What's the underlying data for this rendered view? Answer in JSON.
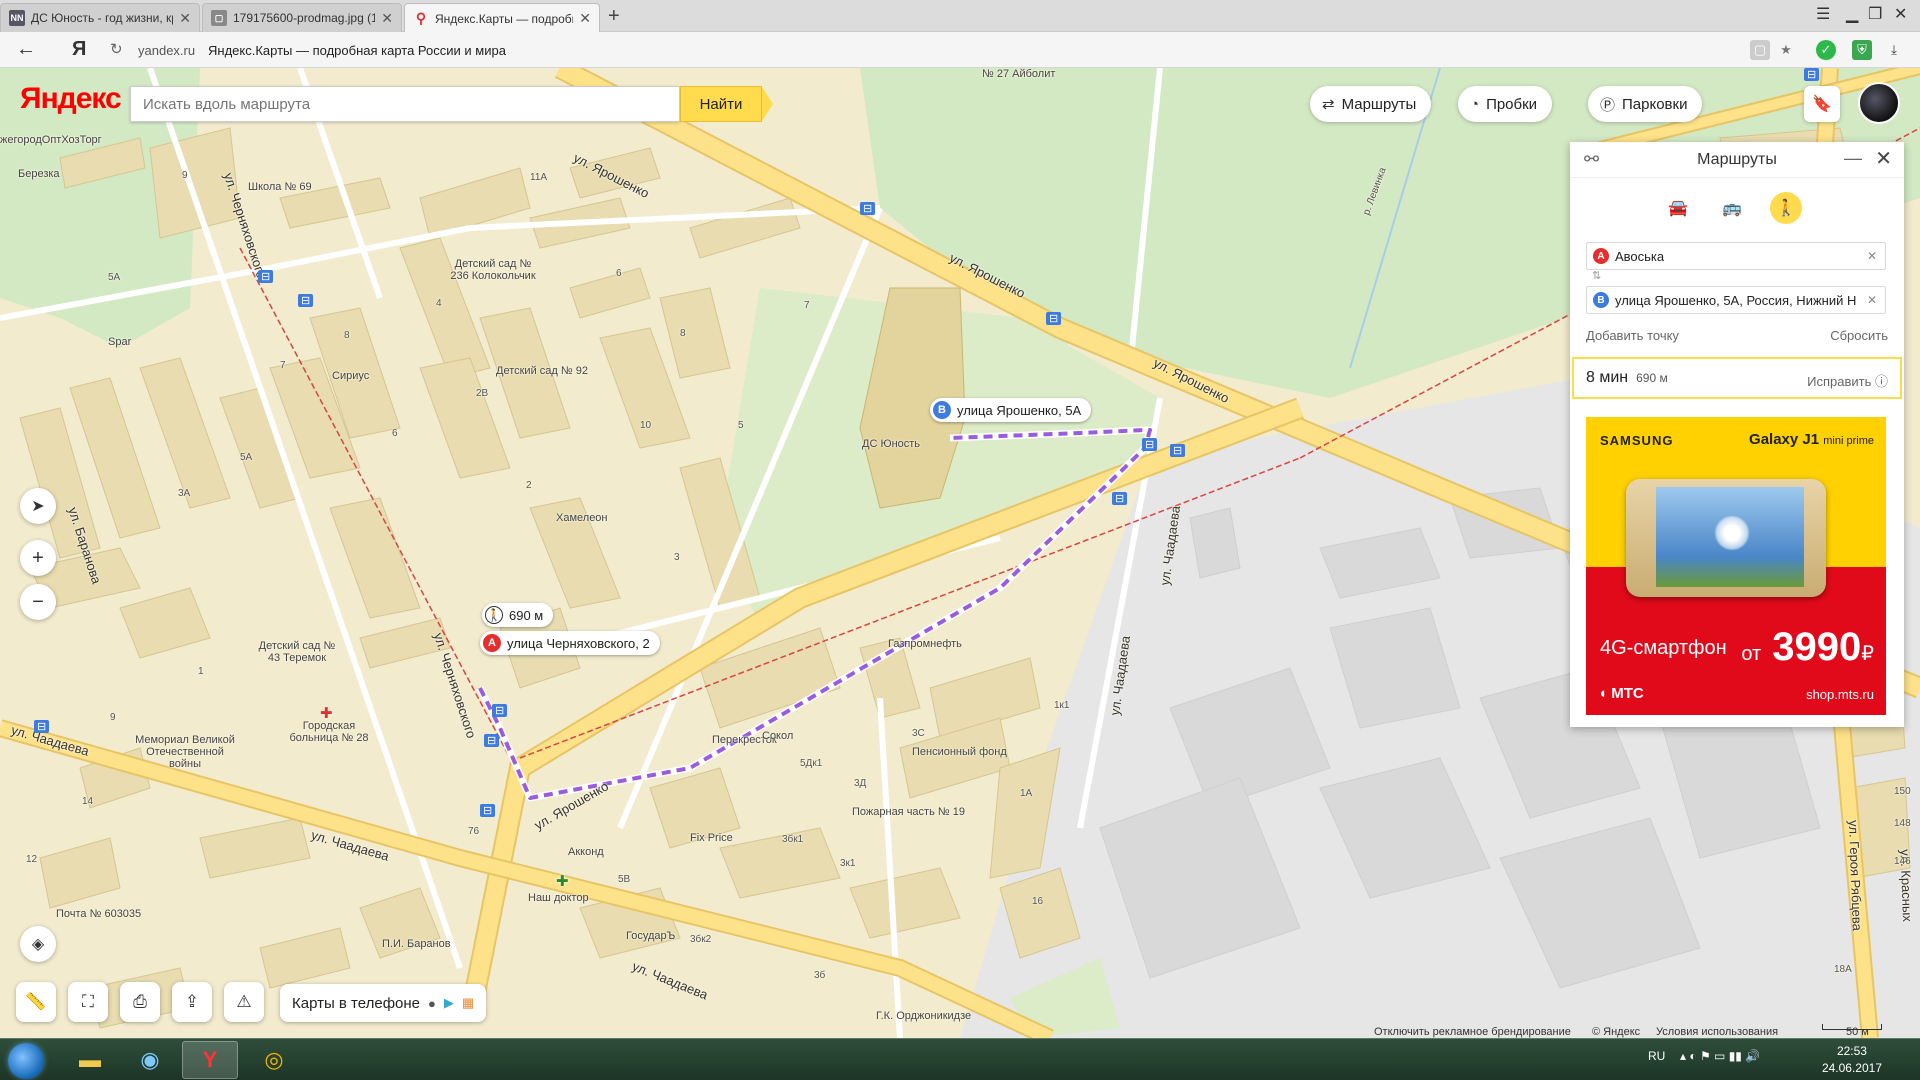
{
  "browser": {
    "tabs": [
      {
        "title": "ДС Юность - год жизни, кр",
        "favicon": "nn-favicon"
      },
      {
        "title": "179175600-prodmag.jpg (1920",
        "favicon": "image-favicon"
      },
      {
        "title": "Яндекс.Карты — подробн",
        "favicon": "maps-pin-favicon"
      }
    ],
    "url_domain": "yandex.ru",
    "url_title": "Яндекс.Карты — подробная карта России и мира"
  },
  "header": {
    "logo": "Яндекс",
    "search_placeholder": "Искать вдоль маршрута",
    "search_button": "Найти",
    "routes_label": "Маршруты",
    "traffic_label": "Пробки",
    "parking_label": "Парковки"
  },
  "route_markers": {
    "distance": "690 м",
    "start_letter": "A",
    "start_label": "улица Черняховского, 2",
    "end_letter": "B",
    "end_label": "улица Ярошенко, 5А"
  },
  "panel": {
    "title": "Маршруты",
    "waypoint_a_letter": "A",
    "waypoint_a": "Авоська",
    "waypoint_b_letter": "B",
    "waypoint_b": "улица Ярошенко, 5А, Россия, Нижний Н",
    "add_point": "Добавить точку",
    "reset": "Сбросить",
    "result_time": "8 мин",
    "result_dist": "690 м",
    "fix": "Исправить",
    "active_mode": "pedestrian"
  },
  "ad": {
    "brand": "SAMSUNG",
    "model": "Galaxy J1",
    "model_suffix": "mini prime",
    "slogan": "4G-смартфон",
    "price_prefix": "от",
    "price": "3990",
    "currency": "₽",
    "operator": "МТС",
    "shop": "shop.mts.ru"
  },
  "map_labels": {
    "streets": [
      "ул. Ярошенко",
      "ул. Ярошенко",
      "ул. Ярошенко",
      "ул. Ярошенко",
      "ул. Черняховского",
      "ул. Черняховского",
      "ул. Чаадаева",
      "ул. Чаадаева",
      "ул. Чаадаева",
      "ул. Чаадаева",
      "ул. Чаадаева",
      "ул. Баранова",
      "ул. Героя Рябцева",
      "ул. Красных"
    ],
    "pois": [
      "Школа № 69",
      "Детский сад № 236 Колокольчик",
      "Детский сад № 92",
      "Сириус",
      "Хамелеон",
      "ДС Юность",
      "Газпромнефть",
      "Перекресток",
      "Сокол",
      "Пенсионный фонд",
      "Пожарная часть № 19",
      "Fix Price",
      "Акконд",
      "Наш доктор",
      "ГосударЪ",
      "П.И. Баранов",
      "Почта № 603035",
      "Детский сад № 43 Теремок",
      "Мемориал Великой Отечественной войны",
      "Городская больница № 28",
      "Г.К. Орджоникидзе",
      "№ 27 Айболит",
      "Spar",
      "Березка",
      "жегородОптХозТорг",
      "р. Левинка"
    ],
    "houses": [
      "11А",
      "9",
      "8",
      "6",
      "7",
      "5",
      "10",
      "4",
      "2",
      "2В",
      "5А",
      "3А",
      "3",
      "1",
      "9",
      "5А",
      "6",
      "8",
      "7",
      "3С",
      "5Дк1",
      "3Д",
      "1А",
      "3бк1",
      "3к1",
      "5В",
      "3бк2",
      "3б",
      "16",
      "1к1",
      "76",
      "14",
      "12",
      "150",
      "148",
      "146",
      "18А"
    ]
  },
  "bottom": {
    "apps_label": "Карты в телефоне",
    "disable_branding": "Отключить рекламное брендирование",
    "copyright": "© Яндекс",
    "terms": "Условия использования",
    "scale": "50 м"
  },
  "taskbar": {
    "lang": "RU",
    "time": "22:53",
    "date": "24.06.2017"
  },
  "colors": {
    "road_major": "#fde28a",
    "road_major_border": "#e8c564",
    "building": "#e8dcb0",
    "green": "#d3e9c4",
    "industrial": "#e6e6e6",
    "route": "#9a5cde",
    "accent": "#ffdb4d",
    "marker_a": "#e62e2e",
    "marker_b": "#3d7be0"
  }
}
